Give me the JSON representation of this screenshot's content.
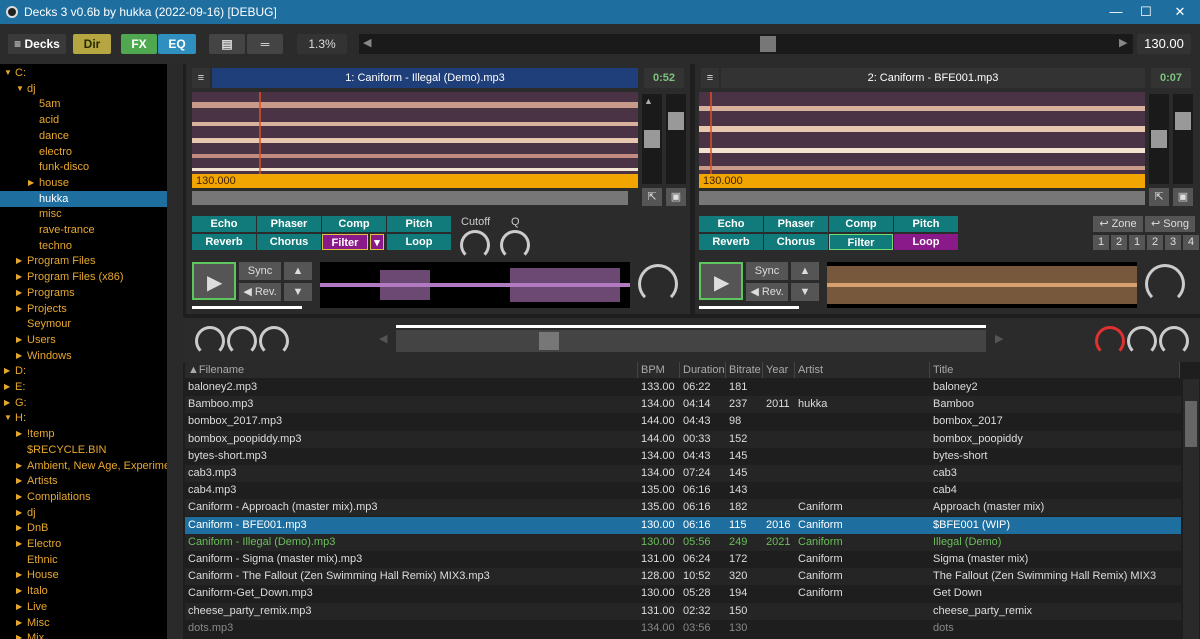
{
  "window": {
    "title": "Decks 3 v0.6b by hukka (2022-09-16) [DEBUG]"
  },
  "toolbar": {
    "decks": "≡ Decks",
    "dir": "Dir",
    "fx": "FX",
    "eq": "EQ",
    "list_icon": "▤",
    "sep_icon": "═",
    "pitch": "1.3%",
    "bpm": "130.00"
  },
  "tree": [
    {
      "label": "C:",
      "lvl": 0,
      "open": true
    },
    {
      "label": "dj",
      "lvl": 1,
      "open": true
    },
    {
      "label": "5am",
      "lvl": 2
    },
    {
      "label": "acid",
      "lvl": 2
    },
    {
      "label": "dance",
      "lvl": 2
    },
    {
      "label": "electro",
      "lvl": 2
    },
    {
      "label": "funk-disco",
      "lvl": 2
    },
    {
      "label": "house",
      "lvl": 2,
      "closed": true
    },
    {
      "label": "hukka",
      "lvl": 2,
      "sel": true
    },
    {
      "label": "misc",
      "lvl": 2
    },
    {
      "label": "rave-trance",
      "lvl": 2
    },
    {
      "label": "techno",
      "lvl": 2
    },
    {
      "label": "Program Files",
      "lvl": 1,
      "closed": true
    },
    {
      "label": "Program Files (x86)",
      "lvl": 1,
      "closed": true
    },
    {
      "label": "Programs",
      "lvl": 1,
      "closed": true
    },
    {
      "label": "Projects",
      "lvl": 1,
      "closed": true
    },
    {
      "label": "Seymour",
      "lvl": 1
    },
    {
      "label": "Users",
      "lvl": 1,
      "closed": true
    },
    {
      "label": "Windows",
      "lvl": 1,
      "closed": true
    },
    {
      "label": "D:",
      "lvl": 0,
      "closed": true
    },
    {
      "label": "E:",
      "lvl": 0,
      "closed": true
    },
    {
      "label": "G:",
      "lvl": 0,
      "closed": true
    },
    {
      "label": "H:",
      "lvl": 0,
      "open": true
    },
    {
      "label": "!temp",
      "lvl": 1,
      "closed": true
    },
    {
      "label": "$RECYCLE.BIN",
      "lvl": 1
    },
    {
      "label": "Ambient, New Age, Experiment",
      "lvl": 1,
      "closed": true
    },
    {
      "label": "Artists",
      "lvl": 1,
      "closed": true
    },
    {
      "label": "Compilations",
      "lvl": 1,
      "closed": true
    },
    {
      "label": "dj",
      "lvl": 1,
      "closed": true
    },
    {
      "label": "DnB",
      "lvl": 1,
      "closed": true
    },
    {
      "label": "Electro",
      "lvl": 1,
      "closed": true
    },
    {
      "label": "Ethnic",
      "lvl": 1
    },
    {
      "label": "House",
      "lvl": 1,
      "closed": true
    },
    {
      "label": "Italo",
      "lvl": 1,
      "closed": true
    },
    {
      "label": "Live",
      "lvl": 1,
      "closed": true
    },
    {
      "label": "Misc",
      "lvl": 1,
      "closed": true
    },
    {
      "label": "Mix",
      "lvl": 1,
      "closed": true
    }
  ],
  "deck1": {
    "title": "1: Caniform - Illegal (Demo).mp3",
    "time": "0:52",
    "bpm": "130.000",
    "fx": [
      "Echo",
      "Phaser",
      "Comp",
      "Pitch",
      "Reverb",
      "Chorus",
      "Filter",
      "Loop"
    ],
    "cutoff": "Cutoff",
    "q": "Q",
    "sync": "Sync",
    "rev": "◀ Rev."
  },
  "deck2": {
    "title": "2: Caniform - BFE001.mp3",
    "time": "0:07",
    "bpm": "130.000",
    "fx": [
      "Echo",
      "Phaser",
      "Comp",
      "Pitch",
      "Reverb",
      "Chorus",
      "Filter",
      "Loop"
    ],
    "zone": "↩ Zone",
    "song": "↩ Song",
    "nums": [
      "1",
      "2",
      "1",
      "2",
      "3",
      "4"
    ],
    "sync": "Sync",
    "rev": "◀ Rev."
  },
  "library": {
    "headers": [
      "▲Filename",
      "BPM",
      "Duration",
      "Bitrate",
      "Year",
      "Artist",
      "Title"
    ],
    "rows": [
      [
        "baloney2.mp3",
        "133.00",
        "06:22",
        "181",
        "",
        "",
        "baloney2"
      ],
      [
        "Bamboo.mp3",
        "134.00",
        "04:14",
        "237",
        "2011",
        "hukka",
        "Bamboo"
      ],
      [
        "bombox_2017.mp3",
        "144.00",
        "04:43",
        "98",
        "",
        "",
        "bombox_2017"
      ],
      [
        "bombox_poopiddy.mp3",
        "144.00",
        "00:33",
        "152",
        "",
        "",
        "bombox_poopiddy"
      ],
      [
        "bytes-short.mp3",
        "134.00",
        "04:43",
        "145",
        "",
        "",
        "bytes-short"
      ],
      [
        "cab3.mp3",
        "134.00",
        "07:24",
        "145",
        "",
        "",
        "cab3"
      ],
      [
        "cab4.mp3",
        "135.00",
        "06:16",
        "143",
        "",
        "",
        "cab4"
      ],
      [
        "Caniform - Approach (master mix).mp3",
        "135.00",
        "06:16",
        "182",
        "",
        "Caniform",
        "Approach (master mix)"
      ],
      [
        "Caniform - BFE001.mp3",
        "130.00",
        "06:16",
        "115",
        "2016",
        "Caniform",
        "$BFE001 (WIP)"
      ],
      [
        "Caniform - Illegal (Demo).mp3",
        "130.00",
        "05:56",
        "249",
        "2021",
        "Caniform",
        "Illegal (Demo)"
      ],
      [
        "Caniform - Sigma (master mix).mp3",
        "131.00",
        "06:24",
        "172",
        "",
        "Caniform",
        "Sigma (master mix)"
      ],
      [
        "Caniform - The Fallout (Zen Swimming Hall Remix) MIX3.mp3",
        "128.00",
        "10:52",
        "320",
        "",
        "Caniform",
        "The Fallout (Zen Swimming Hall Remix) MIX3"
      ],
      [
        "Caniform-Get_Down.mp3",
        "130.00",
        "05:28",
        "194",
        "",
        "Caniform",
        "Get Down"
      ],
      [
        "cheese_party_remix.mp3",
        "131.00",
        "02:32",
        "150",
        "",
        "",
        "cheese_party_remix"
      ],
      [
        "dots.mp3",
        "134.00",
        "03:56",
        "130",
        "",
        "",
        "dots"
      ]
    ]
  }
}
